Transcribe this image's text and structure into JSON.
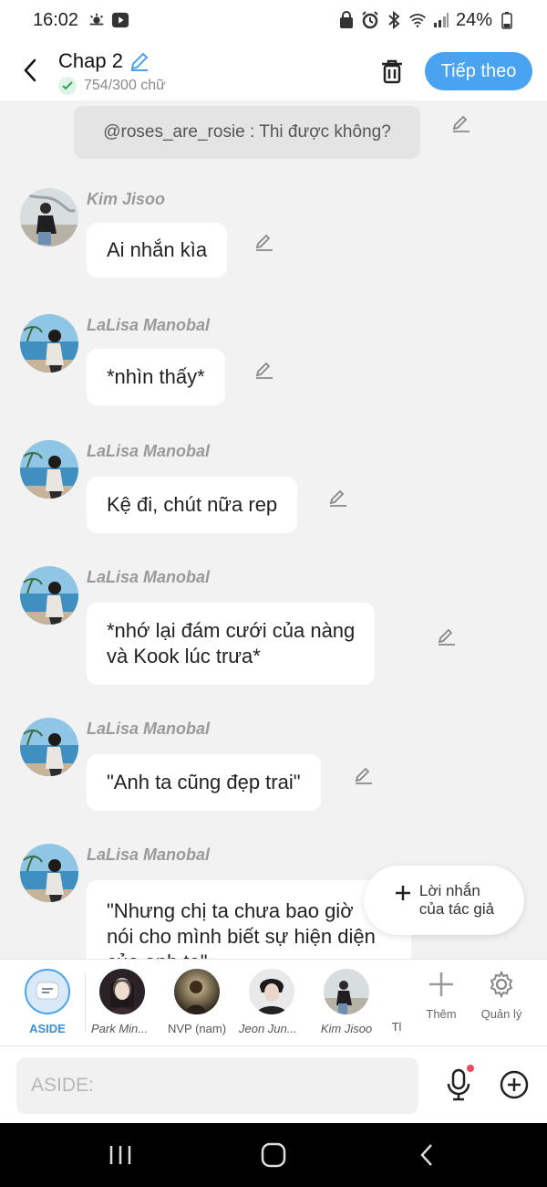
{
  "status_bar": {
    "time": "16:02",
    "battery": "24%"
  },
  "header": {
    "title": "Chap 2",
    "word_count": "754/300 chữ",
    "next_label": "Tiếp theo"
  },
  "quoted": {
    "text": "@roses_are_rosie : Thi được không?"
  },
  "messages": [
    {
      "sender": "Kim Jisoo",
      "lines": [
        "Ai nhắn kìa"
      ]
    },
    {
      "sender": "LaLisa Manobal",
      "lines": [
        "*nhìn thấy*"
      ]
    },
    {
      "sender": "LaLisa Manobal",
      "lines": [
        "Kệ đi, chút nữa rep"
      ]
    },
    {
      "sender": "LaLisa Manobal",
      "lines": [
        "*nhớ lại đám cưới của nàng",
        "và Kook lúc trưa*"
      ]
    },
    {
      "sender": "LaLisa Manobal",
      "lines": [
        "\"Anh ta cũng đẹp trai\""
      ]
    },
    {
      "sender": "LaLisa Manobal",
      "lines": [
        "\"Nhưng chị ta chưa bao giờ",
        "nói cho mình biết sự hiện diện",
        "của anh ta\""
      ]
    }
  ],
  "author_note": {
    "line1": "Lời nhắn",
    "line2": "của tác giả"
  },
  "characters": [
    {
      "label": "ASIDE"
    },
    {
      "label": "Park Min..."
    },
    {
      "label": "NVP (nam)"
    },
    {
      "label": "Jeon Jun..."
    },
    {
      "label": "Kim Jisoo"
    },
    {
      "label": "Tl"
    }
  ],
  "tools": {
    "add_label": "Thêm",
    "manage_label": "Quản lý"
  },
  "input": {
    "placeholder": "ASIDE:"
  },
  "colors": {
    "accent": "#4aa3f0",
    "bubble": "#ffffff",
    "background": "#f2f2f2",
    "notification_dot": "#f04a5e"
  }
}
